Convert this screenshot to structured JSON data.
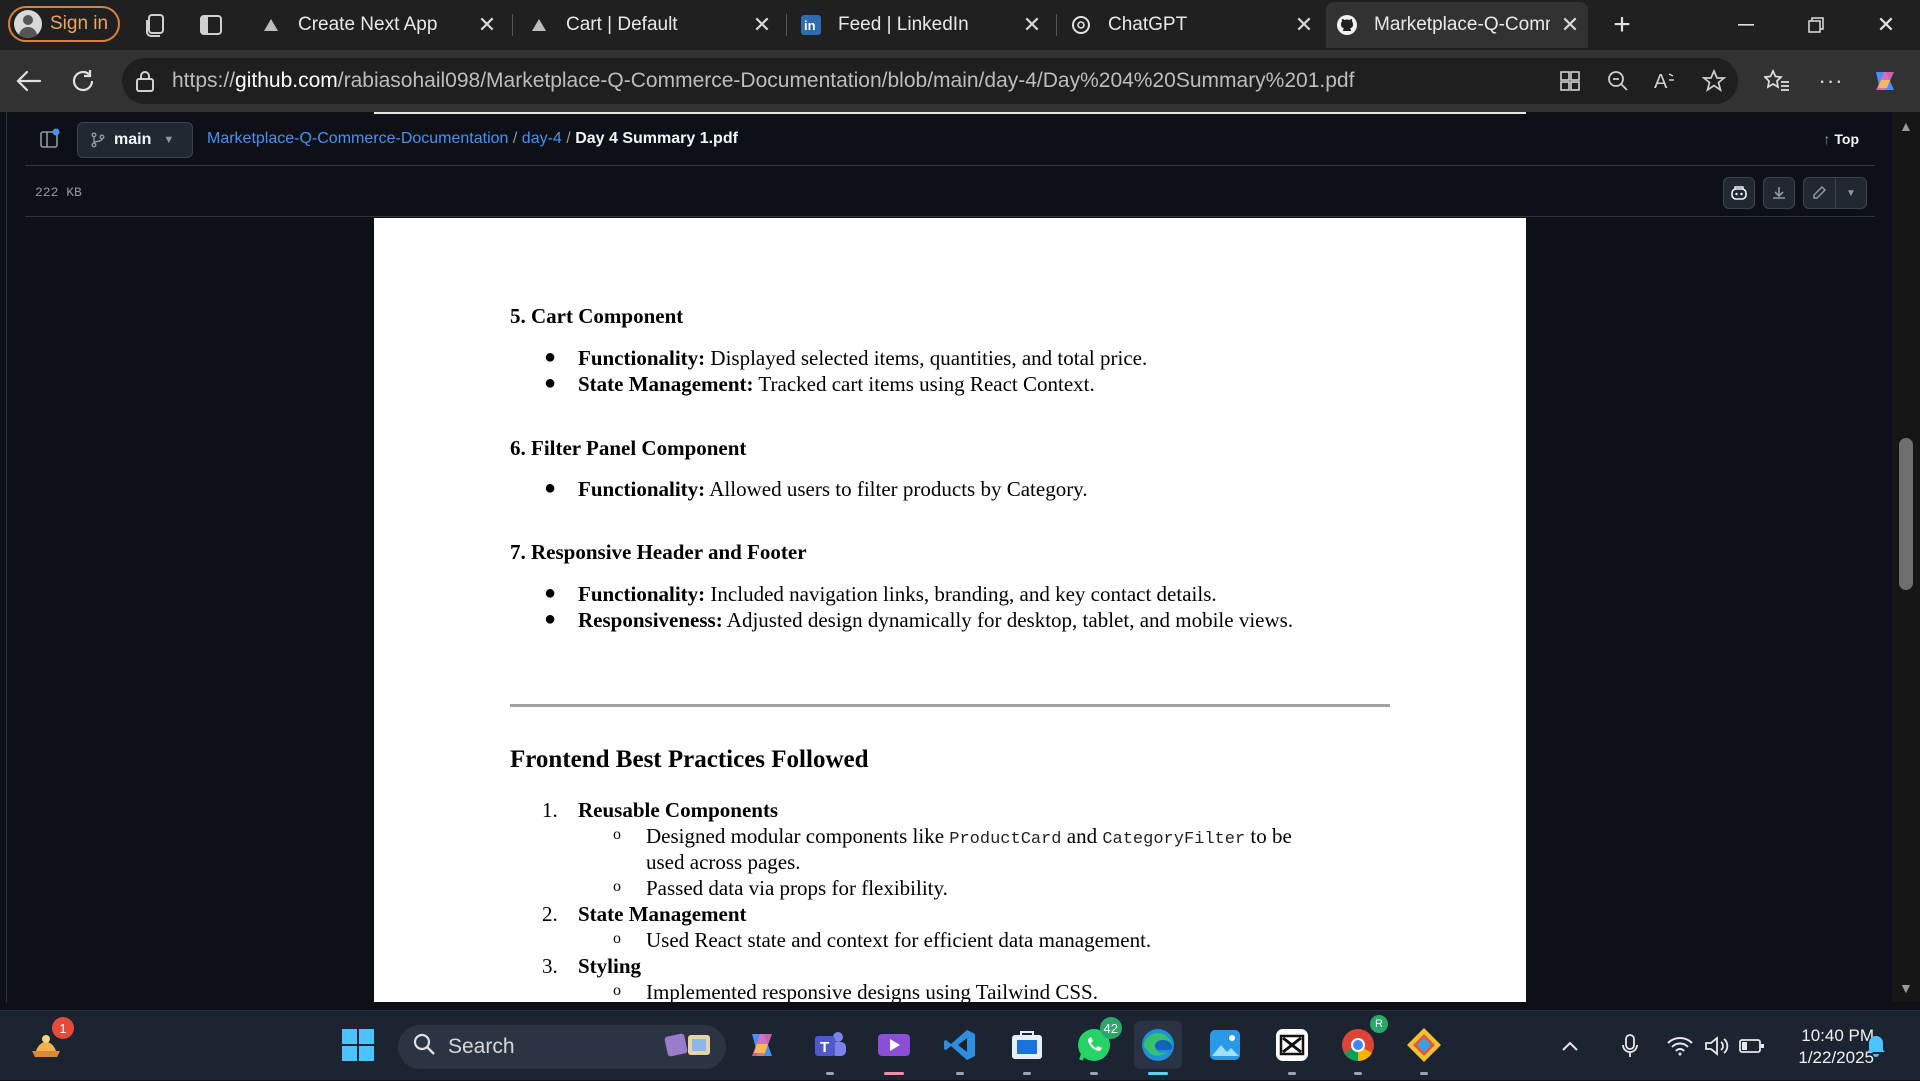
{
  "browser": {
    "signin_label": "Sign in",
    "tabs": [
      {
        "label": "Create Next App",
        "icon": "vercel-triangle-icon"
      },
      {
        "label": "Cart | Default",
        "icon": "vercel-triangle-icon"
      },
      {
        "label": "Feed | LinkedIn",
        "icon": "linkedin-icon"
      },
      {
        "label": "ChatGPT",
        "icon": "chatgpt-icon"
      },
      {
        "label": "Marketplace-Q-Comm",
        "icon": "github-icon",
        "active": true
      }
    ],
    "url_host": "github.com",
    "url_prefix": "https://",
    "url_path": "/rabiasohail098/Marketplace-Q-Commerce-Documentation/blob/main/day-4/Day%204%20Summary%201.pdf"
  },
  "github": {
    "branch": "main",
    "breadcrumb": {
      "repo": "Marketplace-Q-Commerce-Documentation",
      "sep1": "/",
      "folder": "day-4",
      "sep2": "/",
      "file": "Day 4 Summary 1.pdf"
    },
    "top_label": "Top",
    "file_size": "222 KB"
  },
  "pdf": {
    "section5": {
      "heading": "5. Cart Component",
      "items": [
        {
          "key": "Functionality:",
          "text": " Displayed selected items, quantities, and total price."
        },
        {
          "key": "State Management:",
          "text": " Tracked cart items using React Context."
        }
      ]
    },
    "section6": {
      "heading": "6. Filter Panel Component",
      "items": [
        {
          "key": "Functionality:",
          "text": " Allowed users to filter products by Category."
        }
      ]
    },
    "section7": {
      "heading": "7. Responsive Header and Footer",
      "items": [
        {
          "key": "Functionality:",
          "text": " Included navigation links, branding, and key contact details."
        },
        {
          "key": "Responsiveness:",
          "text": " Adjusted design dynamically for desktop, tablet, and mobile views."
        }
      ]
    },
    "practices": {
      "heading": "Frontend Best Practices Followed",
      "list": [
        {
          "num": "1.",
          "title": "Reusable Components"
        },
        {
          "num": "2.",
          "title": "State Management"
        },
        {
          "num": "3.",
          "title": "Styling"
        }
      ],
      "sub1_a": "Designed modular components like ",
      "code1": "ProductCard",
      "sub1_b": " and ",
      "code2": "CategoryFilter",
      "sub1_c": " to be",
      "sub1_cont": "used across pages.",
      "sub1_2": "Passed data via props for flexibility.",
      "sub2_1": "Used React state and context for efficient data management.",
      "sub3_1": "Implemented responsive designs using Tailwind CSS."
    }
  },
  "taskbar": {
    "search_label": "Search",
    "weather_badge": "1",
    "whatsapp_badge": "42",
    "chrome_badge": "R",
    "time": "10:40 PM",
    "date": "1/22/2025"
  }
}
